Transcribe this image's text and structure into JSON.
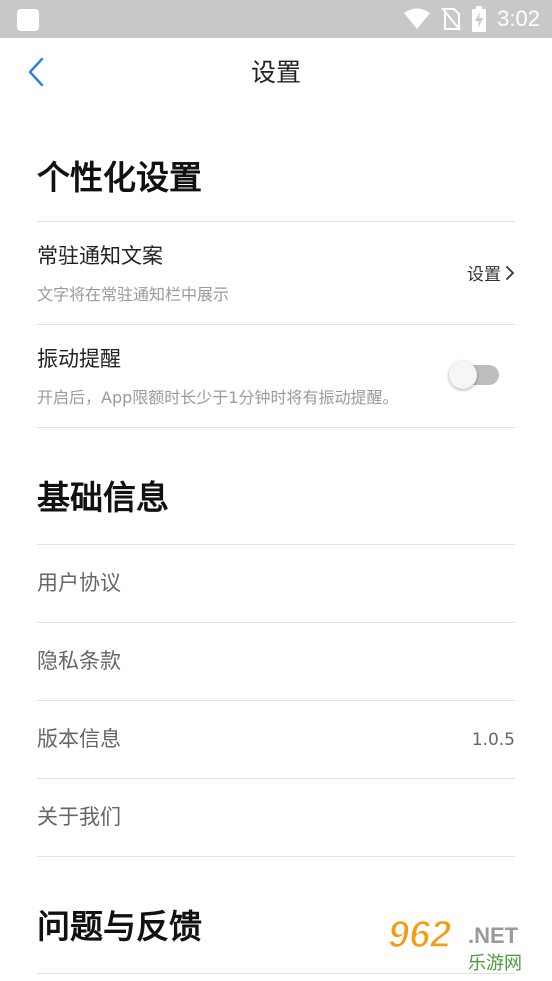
{
  "status_bar": {
    "time": "3:02",
    "icons": [
      "app-notification-icon",
      "wifi-icon",
      "no-sim-icon",
      "battery-charging-icon"
    ]
  },
  "app_bar": {
    "title": "设置",
    "back_icon": "chevron-left-icon",
    "accent_color": "#2f80ed"
  },
  "personalization": {
    "title": "个性化设置",
    "notification_text": {
      "title": "常驻通知文案",
      "description": "文字将在常驻通知栏中展示",
      "action_label": "设置"
    },
    "vibration": {
      "title": "振动提醒",
      "description": "开启后，App限额时长少于1分钟时将有振动提醒。",
      "enabled": false
    }
  },
  "basic_info": {
    "title": "基础信息",
    "items": [
      {
        "label": "用户协议"
      },
      {
        "label": "隐私条款"
      },
      {
        "label": "版本信息",
        "value": "1.0.5"
      },
      {
        "label": "关于我们"
      }
    ]
  },
  "feedback": {
    "title": "问题与反馈"
  },
  "watermark": {
    "number": "962",
    "suffix": ".NET",
    "caption": "乐游网"
  }
}
